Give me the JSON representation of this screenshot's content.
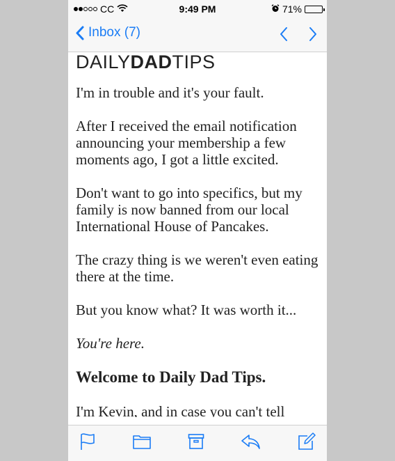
{
  "status_bar": {
    "signal_dots_filled": 2,
    "signal_dots_total": 5,
    "carrier": "CC",
    "wifi_icon": "wifi-icon",
    "time": "9:49 PM",
    "alarm_icon": "alarm-icon",
    "battery_percent": "71%",
    "battery_level": 0.71
  },
  "nav": {
    "back_label": "Inbox (7)",
    "prev_icon": "chevron-up-icon",
    "next_icon": "chevron-down-icon",
    "accent_color": "#1a7cf5"
  },
  "email": {
    "logo_light_1": "DAILY",
    "logo_bold": "DAD",
    "logo_light_2": "TIPS",
    "paragraphs": [
      "I'm in trouble and it's your fault.",
      "After I received the email notification announcing your membership a few moments ago, I got a little excited.",
      "Don't want to go into specifics, but my family is now banned from our local International House of Pancakes.",
      "The crazy thing is we weren't even eating there at the time.",
      "But you know what? It was worth it..."
    ],
    "italic_line": "You're here.",
    "heading": "Welcome to Daily Dad Tips.",
    "last_paragraph": "I'm Kevin, and in case you can't tell"
  },
  "toolbar": {
    "items": [
      "flag-icon",
      "folder-icon",
      "archive-icon",
      "reply-icon",
      "compose-icon"
    ]
  }
}
